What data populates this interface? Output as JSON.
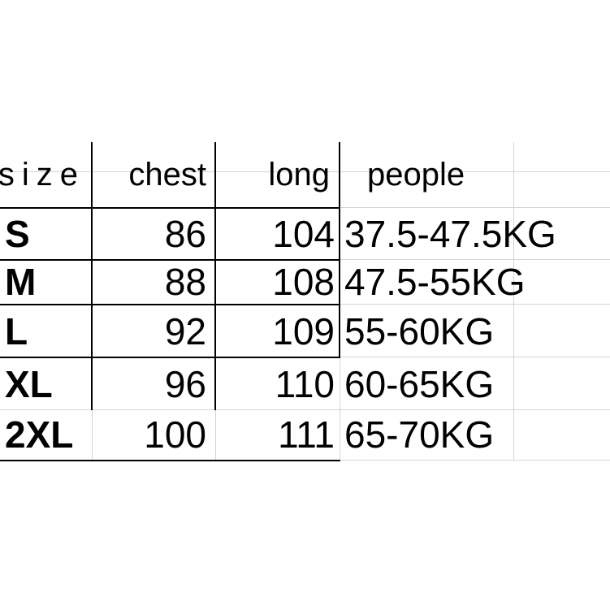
{
  "table": {
    "name": "size-chart",
    "headers": [
      "size",
      "chest",
      "long",
      "people"
    ],
    "rows": [
      {
        "size": "S",
        "chest": "86",
        "long": "104",
        "people": "37.5-47.5KG"
      },
      {
        "size": "M",
        "chest": "88",
        "long": "108",
        "people": "47.5-55KG"
      },
      {
        "size": "L",
        "chest": "92",
        "long": "109",
        "people": "55-60KG"
      },
      {
        "size": "XL",
        "chest": "96",
        "long": "110",
        "people": "60-65KG"
      },
      {
        "size": "2XL",
        "chest": "100",
        "long": "111",
        "people": "65-70KG"
      }
    ]
  },
  "colors": {
    "background": "#ffffff",
    "text": "#000000",
    "table_border": "#000000",
    "grid_line": "#d4d4d4"
  }
}
